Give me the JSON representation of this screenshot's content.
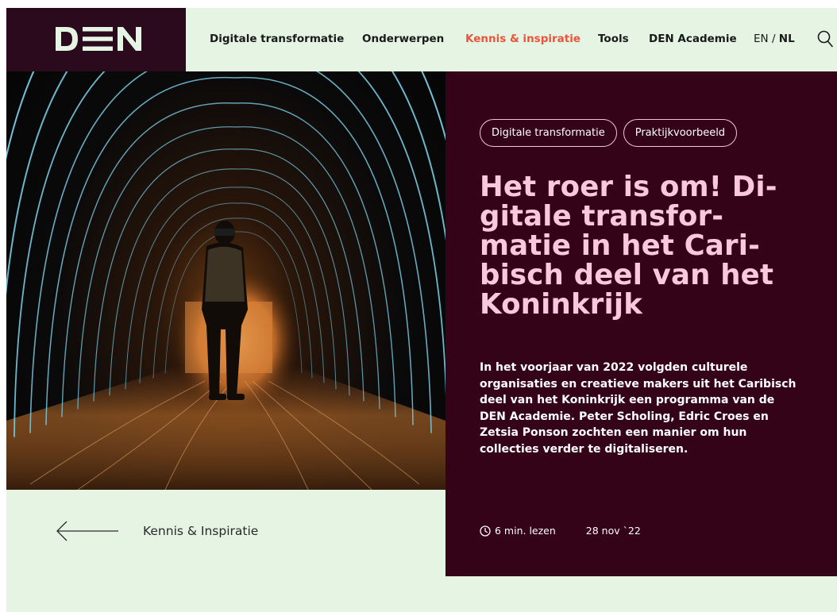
{
  "brand": {
    "logo_text": "DEN",
    "logo_color": "#e5f4e3",
    "logo_bg": "#2c0a1e"
  },
  "nav": {
    "items": [
      {
        "label": "Digitale transformatie",
        "active": false
      },
      {
        "label": "Onderwerpen",
        "active": false
      },
      {
        "label": "Kennis & inspiratie",
        "active": true
      },
      {
        "label": "Tools",
        "active": false
      },
      {
        "label": "DEN Academie",
        "active": false
      }
    ],
    "lang_en": "EN",
    "lang_sep": "/",
    "lang_nl": "NL",
    "search_icon": "search-icon",
    "active_color": "#e8553a"
  },
  "article": {
    "tags": [
      "Digitale transformatie",
      "Praktijkvoorbeeld"
    ],
    "title": "Het roer is om! Digitale transformatie in het Caribisch deel van het Koninkrijk",
    "title_lines": [
      "Het roer is om! Di-",
      "gitale transfor-",
      "matie in het Cari-",
      "bisch deel van het",
      "Koninkrijk"
    ],
    "lead": "In het voorjaar van 2022 volgden culturele organisaties en creatieve makers uit het Caribisch deel van het Koninkrijk een programma van de DEN Academie. Peter Scholing, Edric Croes en Zetsia Ponson zochten een manier om hun collecties verder te digitaliseren.",
    "read_time": "6 min. lezen",
    "date": "28 nov `22",
    "clock_icon": "clock-icon",
    "panel_color": "#350318",
    "title_color": "#f8c8dd"
  },
  "back_link": {
    "label": "Kennis & Inspiratie",
    "icon": "arrow-left-icon"
  },
  "page_bg": "#e5f4e3"
}
